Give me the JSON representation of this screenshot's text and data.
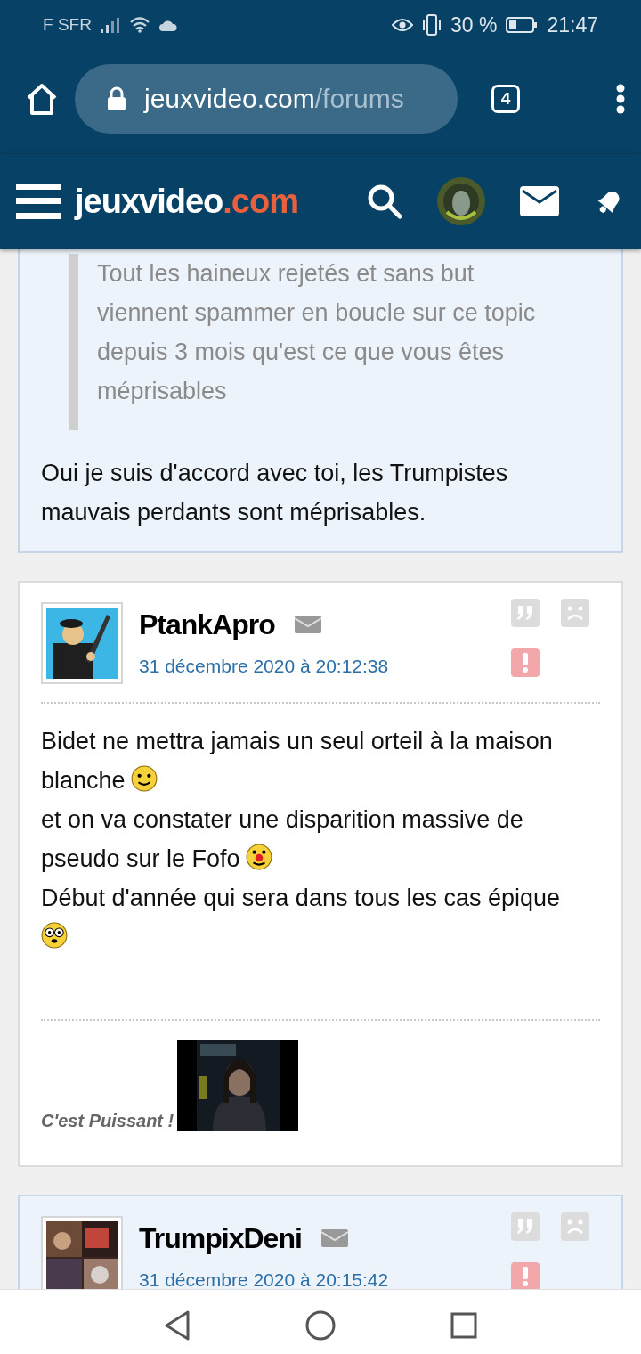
{
  "status_bar": {
    "carrier": "F SFR",
    "battery": "30 %",
    "time": "21:47"
  },
  "browser": {
    "url_host": "jeuxvideo.com",
    "url_path": "/forums",
    "tab_count": "4"
  },
  "site_header": {
    "logo_main": "jeuxvideo",
    "logo_accent": ".com"
  },
  "posts": [
    {
      "highlighted": true,
      "quote": "Tout les haineux rejetés et sans but viennent spammer en boucle sur ce topic depuis 3 mois qu'est ce que vous êtes méprisables",
      "body": [
        {
          "text": "Oui je suis d'accord avec toi, les Trumpistes mauvais perdants sont méprisables."
        }
      ]
    },
    {
      "highlighted": false,
      "author": "PtankApro",
      "date": "31 décembre 2020 à 20:12:38",
      "body": [
        {
          "text": "Bidet ne mettra jamais un seul orteil à la maison"
        },
        {
          "text": "blanche",
          "kind": "smile"
        },
        {
          "text": "et on va constater une disparition massive de"
        },
        {
          "text": "pseudo sur le Fofo",
          "kind": "clown"
        },
        {
          "text": "Début d'année qui sera dans tous les cas épique"
        },
        {
          "kind": "crazy"
        }
      ],
      "signature": "C'est Puissant !"
    },
    {
      "highlighted": true,
      "author": "TrumpixDeni",
      "date": "31 décembre 2020 à 20:15:42"
    }
  ]
}
